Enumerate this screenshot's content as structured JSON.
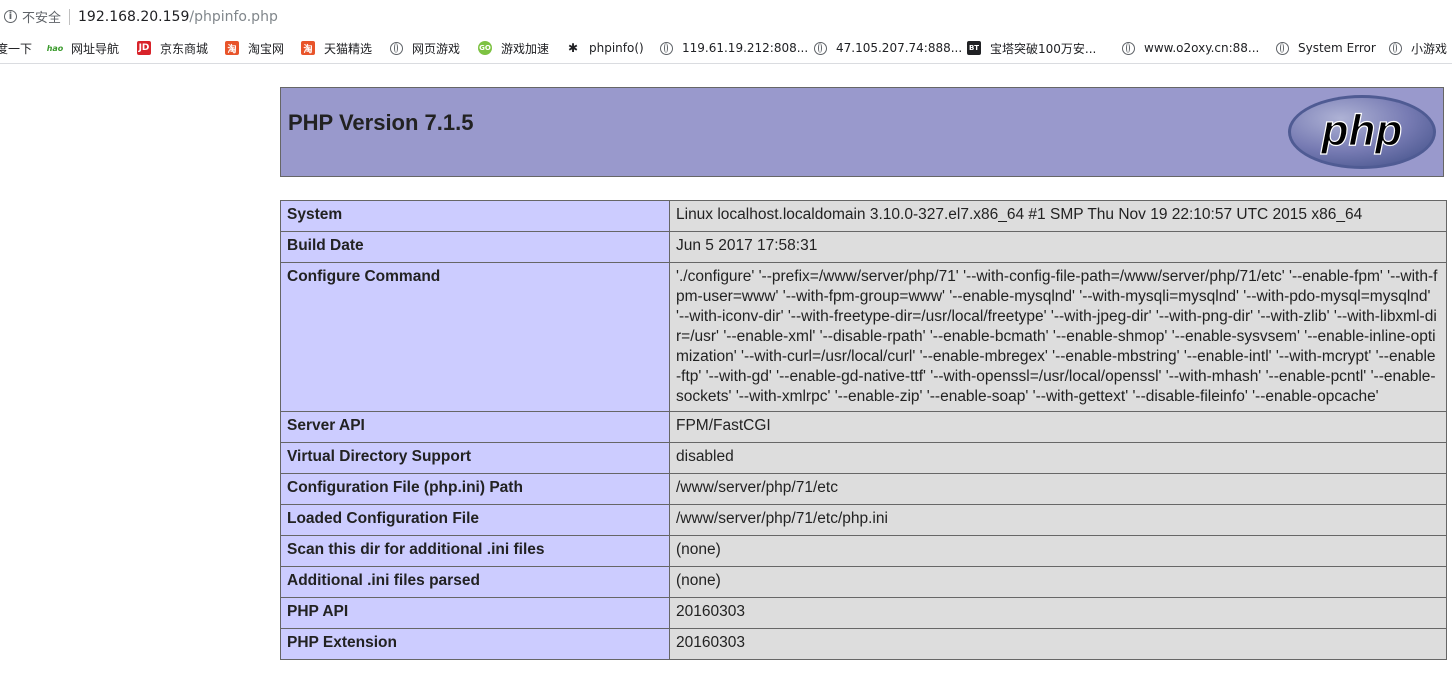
{
  "addressbar": {
    "security_label": "不安全",
    "url_host": "192.168.20.159",
    "url_path": "/phpinfo.php"
  },
  "bookmarks": [
    {
      "label": "度一下",
      "icon": "none"
    },
    {
      "label": "网址导航",
      "icon": "hao123-icon"
    },
    {
      "label": "京东商城",
      "icon": "jd-icon"
    },
    {
      "label": "淘宝网",
      "icon": "taobao-icon"
    },
    {
      "label": "天猫精选",
      "icon": "tmall-icon"
    },
    {
      "label": "网页游戏",
      "icon": "globe-icon"
    },
    {
      "label": "游戏加速",
      "icon": "speedup-icon"
    },
    {
      "label": "phpinfo()",
      "icon": "bug-icon"
    },
    {
      "label": "119.61.19.212:808...",
      "icon": "globe-icon"
    },
    {
      "label": "47.105.207.74:888...",
      "icon": "globe-icon"
    },
    {
      "label": "宝塔突破100万安...",
      "icon": "bt-icon"
    },
    {
      "label": "www.o2oxy.cn:88...",
      "icon": "globe-icon"
    },
    {
      "label": "System Error",
      "icon": "globe-icon"
    },
    {
      "label": "小游戏",
      "icon": "globe-icon"
    }
  ],
  "php": {
    "title": "PHP Version 7.1.5",
    "logo_text": "php"
  },
  "info_rows": [
    {
      "key": "System",
      "value": "Linux localhost.localdomain 3.10.0-327.el7.x86_64 #1 SMP Thu Nov 19 22:10:57 UTC 2015 x86_64"
    },
    {
      "key": "Build Date",
      "value": "Jun 5 2017 17:58:31"
    },
    {
      "key": "Configure Command",
      "value": "'./configure' '--prefix=/www/server/php/71' '--with-config-file-path=/www/server/php/71/etc' '--enable-fpm' '--with-fpm-user=www' '--with-fpm-group=www' '--enable-mysqlnd' '--with-mysqli=mysqlnd' '--with-pdo-mysql=mysqlnd' '--with-iconv-dir' '--with-freetype-dir=/usr/local/freetype' '--with-jpeg-dir' '--with-png-dir' '--with-zlib' '--with-libxml-dir=/usr' '--enable-xml' '--disable-rpath' '--enable-bcmath' '--enable-shmop' '--enable-sysvsem' '--enable-inline-optimization' '--with-curl=/usr/local/curl' '--enable-mbregex' '--enable-mbstring' '--enable-intl' '--with-mcrypt' '--enable-ftp' '--with-gd' '--enable-gd-native-ttf' '--with-openssl=/usr/local/openssl' '--with-mhash' '--enable-pcntl' '--enable-sockets' '--with-xmlrpc' '--enable-zip' '--enable-soap' '--with-gettext' '--disable-fileinfo' '--enable-opcache'"
    },
    {
      "key": "Server API",
      "value": "FPM/FastCGI"
    },
    {
      "key": "Virtual Directory Support",
      "value": "disabled"
    },
    {
      "key": "Configuration File (php.ini) Path",
      "value": "/www/server/php/71/etc"
    },
    {
      "key": "Loaded Configuration File",
      "value": "/www/server/php/71/etc/php.ini"
    },
    {
      "key": "Scan this dir for additional .ini files",
      "value": "(none)"
    },
    {
      "key": "Additional .ini files parsed",
      "value": "(none)"
    },
    {
      "key": "PHP API",
      "value": "20160303"
    },
    {
      "key": "PHP Extension",
      "value": "20160303"
    }
  ],
  "colors": {
    "header_bg": "#9999cc",
    "key_bg": "#ccccff",
    "value_bg": "#dddddd",
    "border": "#666666"
  }
}
